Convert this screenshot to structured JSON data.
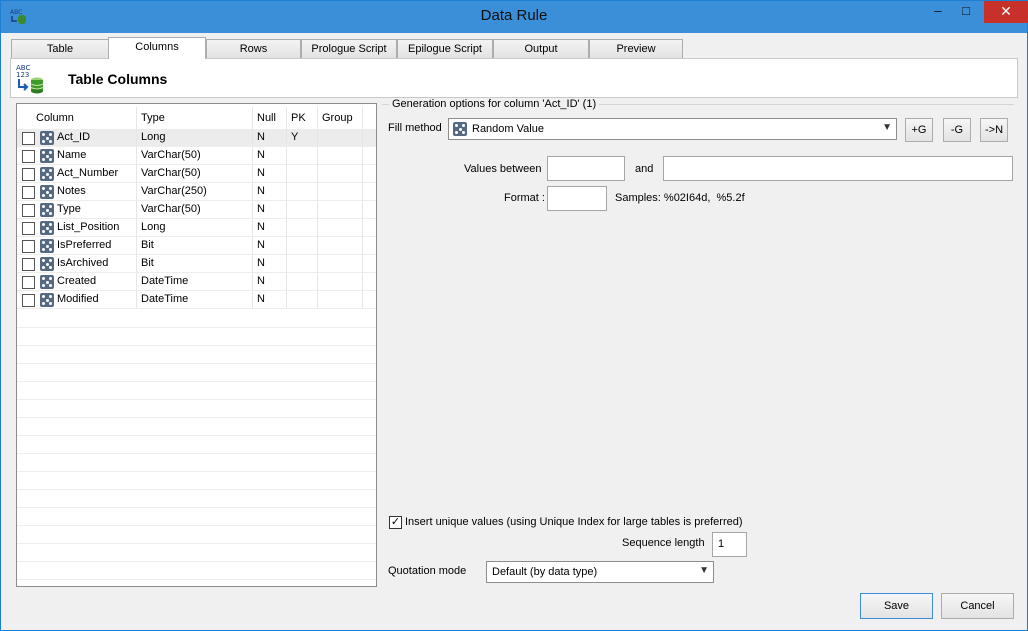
{
  "window": {
    "title": "Data Rule",
    "minimize": "–",
    "maximize": "□",
    "close": "✕"
  },
  "tabs": [
    {
      "label": "Table",
      "active": false
    },
    {
      "label": "Columns",
      "active": true
    },
    {
      "label": "Rows",
      "active": false
    },
    {
      "label": "Prologue Script",
      "active": false
    },
    {
      "label": "Epilogue Script",
      "active": false
    },
    {
      "label": "Output",
      "active": false
    },
    {
      "label": "Preview",
      "active": false
    }
  ],
  "header": {
    "icon": "abc-123-database-icon",
    "icon_text_top": "ABC",
    "icon_text_bottom": "123",
    "title": "Table Columns"
  },
  "grid": {
    "columns": [
      "Column",
      "Type",
      "Null",
      "PK",
      "Group"
    ],
    "rows": [
      {
        "name": "Act_ID",
        "type": "Long",
        "null": "N",
        "pk": "Y",
        "group": "",
        "selected": true
      },
      {
        "name": "Name",
        "type": "VarChar(50)",
        "null": "N",
        "pk": "",
        "group": "",
        "selected": false
      },
      {
        "name": "Act_Number",
        "type": "VarChar(50)",
        "null": "N",
        "pk": "",
        "group": "",
        "selected": false
      },
      {
        "name": "Notes",
        "type": "VarChar(250)",
        "null": "N",
        "pk": "",
        "group": "",
        "selected": false
      },
      {
        "name": "Type",
        "type": "VarChar(50)",
        "null": "N",
        "pk": "",
        "group": "",
        "selected": false
      },
      {
        "name": "List_Position",
        "type": "Long",
        "null": "N",
        "pk": "",
        "group": "",
        "selected": false
      },
      {
        "name": "IsPreferred",
        "type": "Bit",
        "null": "N",
        "pk": "",
        "group": "",
        "selected": false
      },
      {
        "name": "IsArchived",
        "type": "Bit",
        "null": "N",
        "pk": "",
        "group": "",
        "selected": false
      },
      {
        "name": "Created",
        "type": "DateTime",
        "null": "N",
        "pk": "",
        "group": "",
        "selected": false
      },
      {
        "name": "Modified",
        "type": "DateTime",
        "null": "N",
        "pk": "",
        "group": "",
        "selected": false
      }
    ]
  },
  "generation": {
    "group_title": "Generation options for column 'Act_ID' (1)",
    "fill_method_label": "Fill method",
    "fill_method_value": "Random Value",
    "btn_add_group": "+G",
    "btn_remove_group": "-G",
    "btn_to_n": "->N",
    "values_between_label": "Values between",
    "values_from": "",
    "and_label": "and",
    "values_to": "",
    "format_label": "Format :",
    "format_value": "",
    "samples_text": "Samples: %02I64d,  %5.2f",
    "unique_checked": true,
    "unique_label": "Insert unique values (using Unique Index for large tables is preferred)",
    "sequence_length_label": "Sequence length",
    "sequence_length_value": "1",
    "quotation_label": "Quotation mode",
    "quotation_value": "Default (by data type)"
  },
  "footer": {
    "save": "Save",
    "cancel": "Cancel"
  }
}
